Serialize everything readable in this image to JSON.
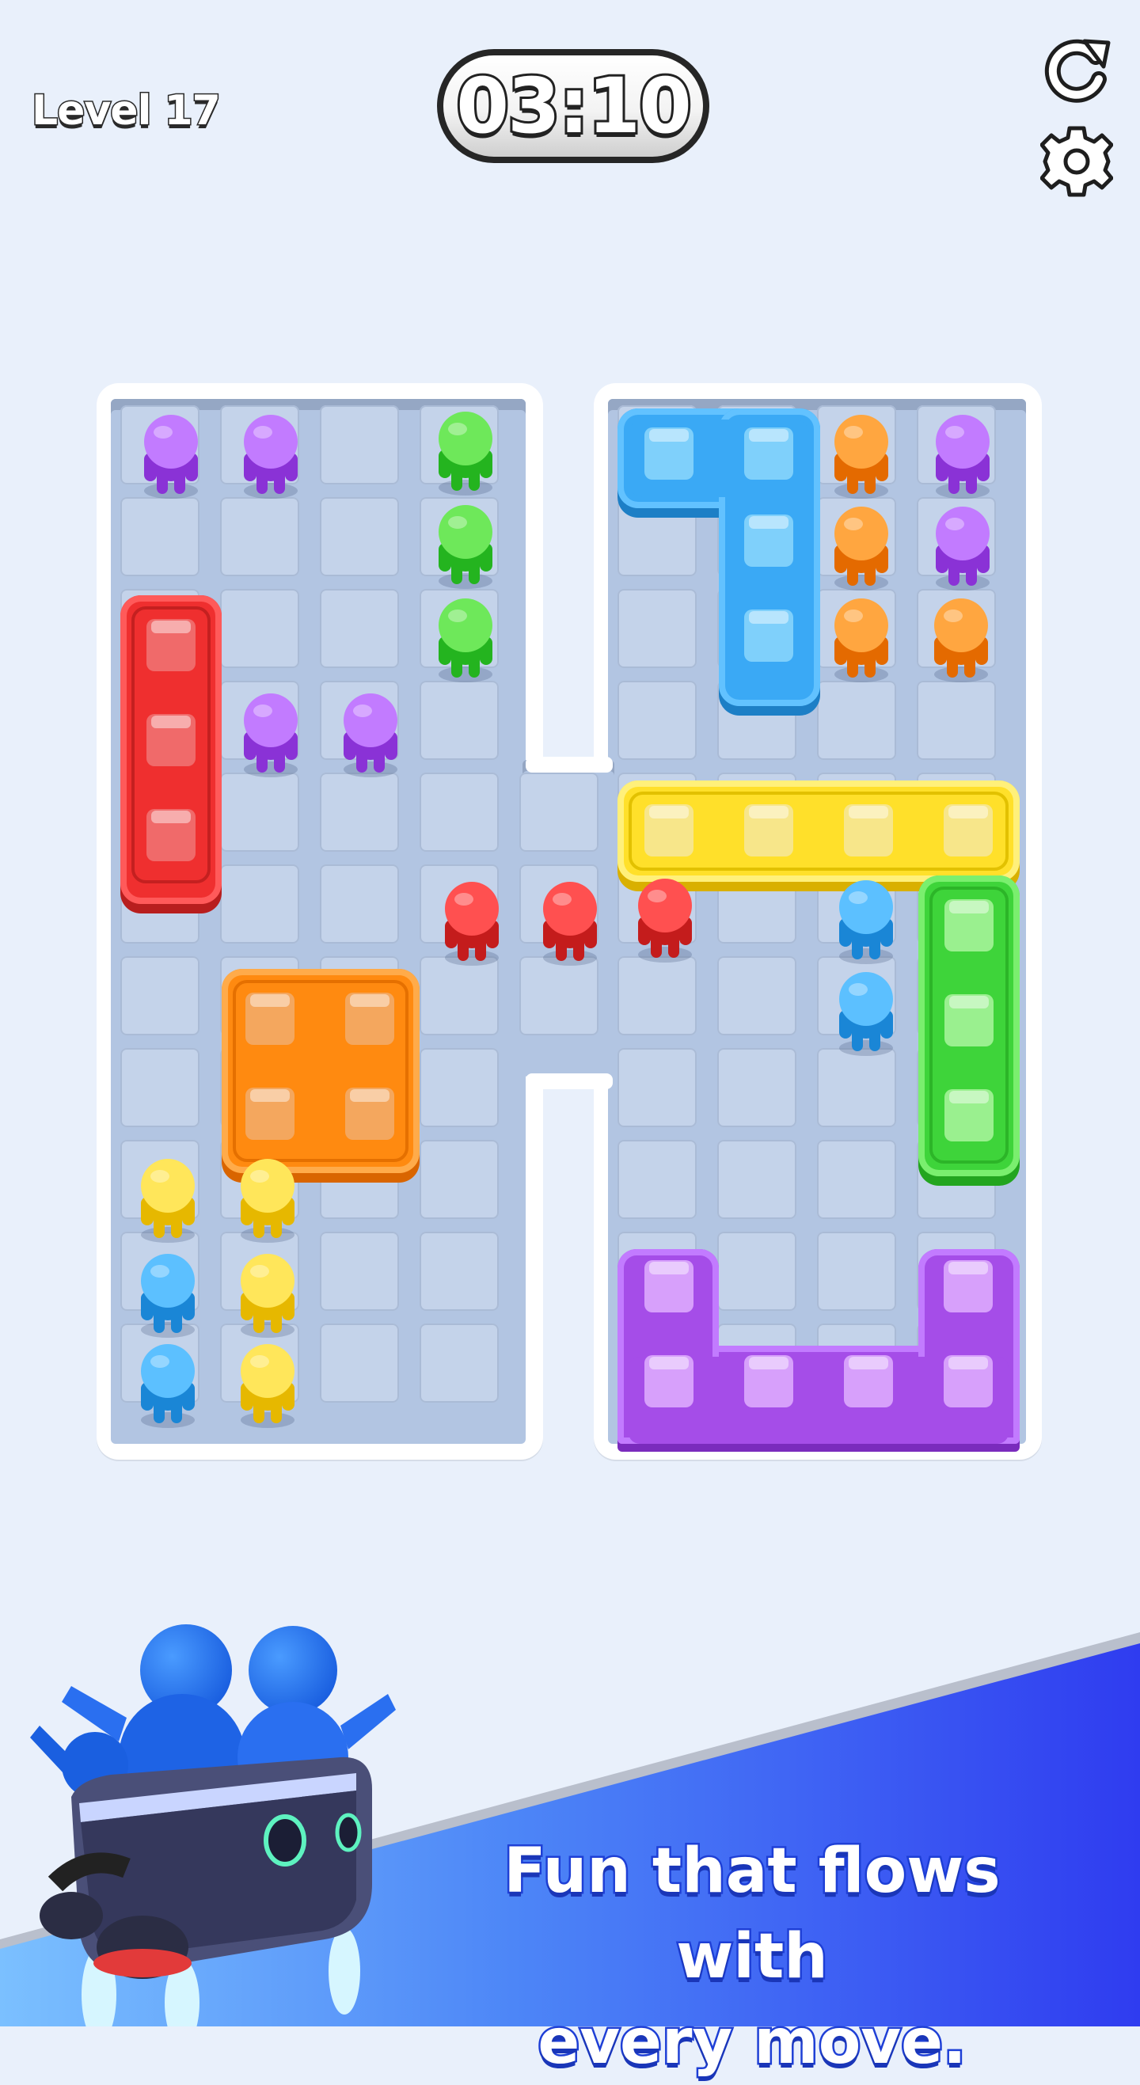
{
  "hud": {
    "level_label": "Level 17",
    "timer": "03:10",
    "restart_icon": "restart-icon",
    "settings_icon": "gear-icon"
  },
  "colors": {
    "purple": "#a54de8",
    "green": "#3ed43a",
    "orange": "#ff8a10",
    "red": "#ef2f2f",
    "blue": "#2fa8f5",
    "yellow": "#ffd719",
    "seat_blue": "#3aa9f5",
    "seat_yellow": "#ffe02a"
  },
  "board": {
    "vehicles": [
      {
        "name": "red-bus",
        "color": "red",
        "seats": 3
      },
      {
        "name": "blue-l-bus",
        "color": "blue",
        "seats": 4
      },
      {
        "name": "yellow-bus",
        "color": "yellow",
        "seats": 4
      },
      {
        "name": "green-bus",
        "color": "green",
        "seats": 3
      },
      {
        "name": "orange-bus",
        "color": "orange",
        "seats": 4
      },
      {
        "name": "purple-u-bus",
        "color": "purple",
        "seats": 6
      }
    ],
    "people": [
      "purple",
      "purple",
      "green",
      "green",
      "green",
      "purple",
      "purple",
      "orange",
      "orange",
      "orange",
      "purple",
      "purple",
      "orange",
      "red",
      "red",
      "red",
      "blue",
      "blue",
      "yellow",
      "yellow",
      "blue",
      "yellow",
      "blue",
      "yellow"
    ]
  },
  "promo": {
    "line1": "Fun that flows with",
    "line2": "every move."
  }
}
